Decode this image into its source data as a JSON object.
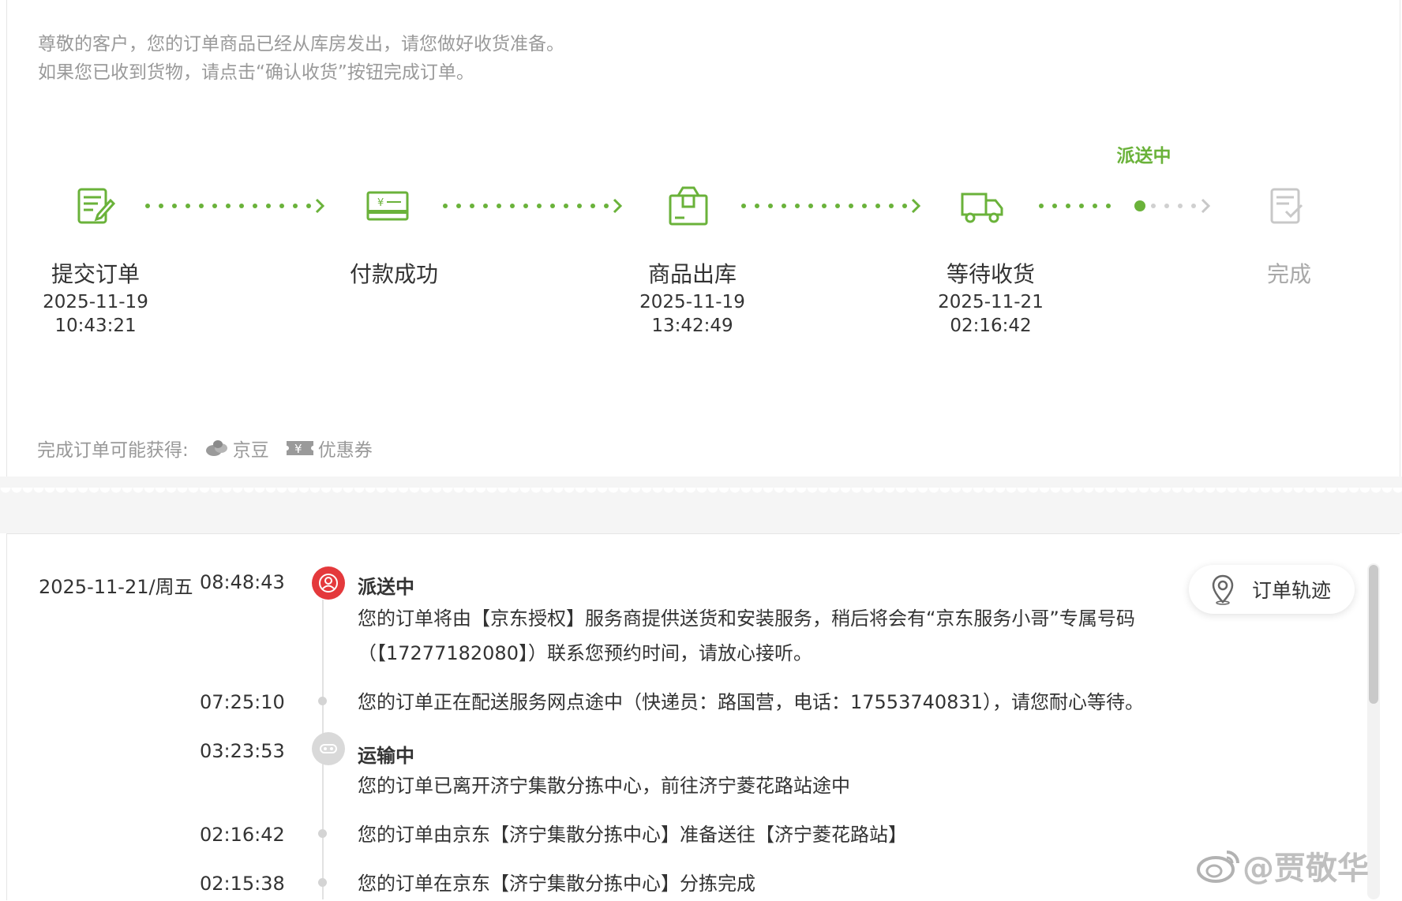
{
  "notice": {
    "line1": "尊敬的客户，您的订单商品已经从库房发出，请您做好收货准备。",
    "line2": "如果您已收到货物，请点击“确认收货”按钮完成订单。"
  },
  "progress": {
    "current_status": "派送中",
    "steps": [
      {
        "name": "提交订单",
        "date": "2025-11-19",
        "time": "10:43:21",
        "icon": "order-form-icon",
        "state": "done"
      },
      {
        "name": "付款成功",
        "date": "",
        "time": "",
        "icon": "payment-card-icon",
        "state": "done"
      },
      {
        "name": "商品出库",
        "date": "2025-11-19",
        "time": "13:42:49",
        "icon": "package-box-icon",
        "state": "done"
      },
      {
        "name": "等待收货",
        "date": "2025-11-21",
        "time": "02:16:42",
        "icon": "delivery-truck-icon",
        "state": "active"
      },
      {
        "name": "完成",
        "date": "",
        "time": "",
        "icon": "completed-form-icon",
        "state": "pending"
      }
    ],
    "colors": {
      "done": "#6ab23a",
      "pending": "#c8c8c8"
    }
  },
  "rewards": {
    "label": "完成订单可能获得:",
    "items": [
      {
        "label": "京豆",
        "icon": "jingdou-bean-icon"
      },
      {
        "label": "优惠券",
        "icon": "coupon-icon"
      }
    ]
  },
  "tracking": {
    "map_button": "订单轨迹",
    "date": "2025-11-21/周五",
    "entries": [
      {
        "time": "08:48:43",
        "title": "派送中",
        "lines": [
          "您的订单将由【京东授权】服务商提供送货和安装服务，稍后将会有“京东服务小哥”专属号码",
          "（【17277182080】）联系您预约时间，请放心接听。"
        ]
      },
      {
        "time": "07:25:10",
        "title": "",
        "lines": [
          "您的订单正在配送服务网点途中（快递员：路国营，电话：17553740831），请您耐心等待。"
        ]
      },
      {
        "time": "03:23:53",
        "title": "运输中",
        "lines": [
          "您的订单已离开济宁集散分拣中心，前往济宁菱花路站途中"
        ]
      },
      {
        "time": "02:16:42",
        "title": "",
        "lines": [
          "您的订单由京东【济宁集散分拣中心】准备送往【济宁菱花路站】"
        ]
      },
      {
        "time": "02:15:38",
        "title": "",
        "lines": [
          "您的订单在京东【济宁集散分拣中心】分拣完成"
        ]
      }
    ],
    "colors": {
      "dispatch_badge": "#e4393c",
      "transit_badge": "#d9d9d9"
    }
  },
  "watermark": "@贾敬华"
}
